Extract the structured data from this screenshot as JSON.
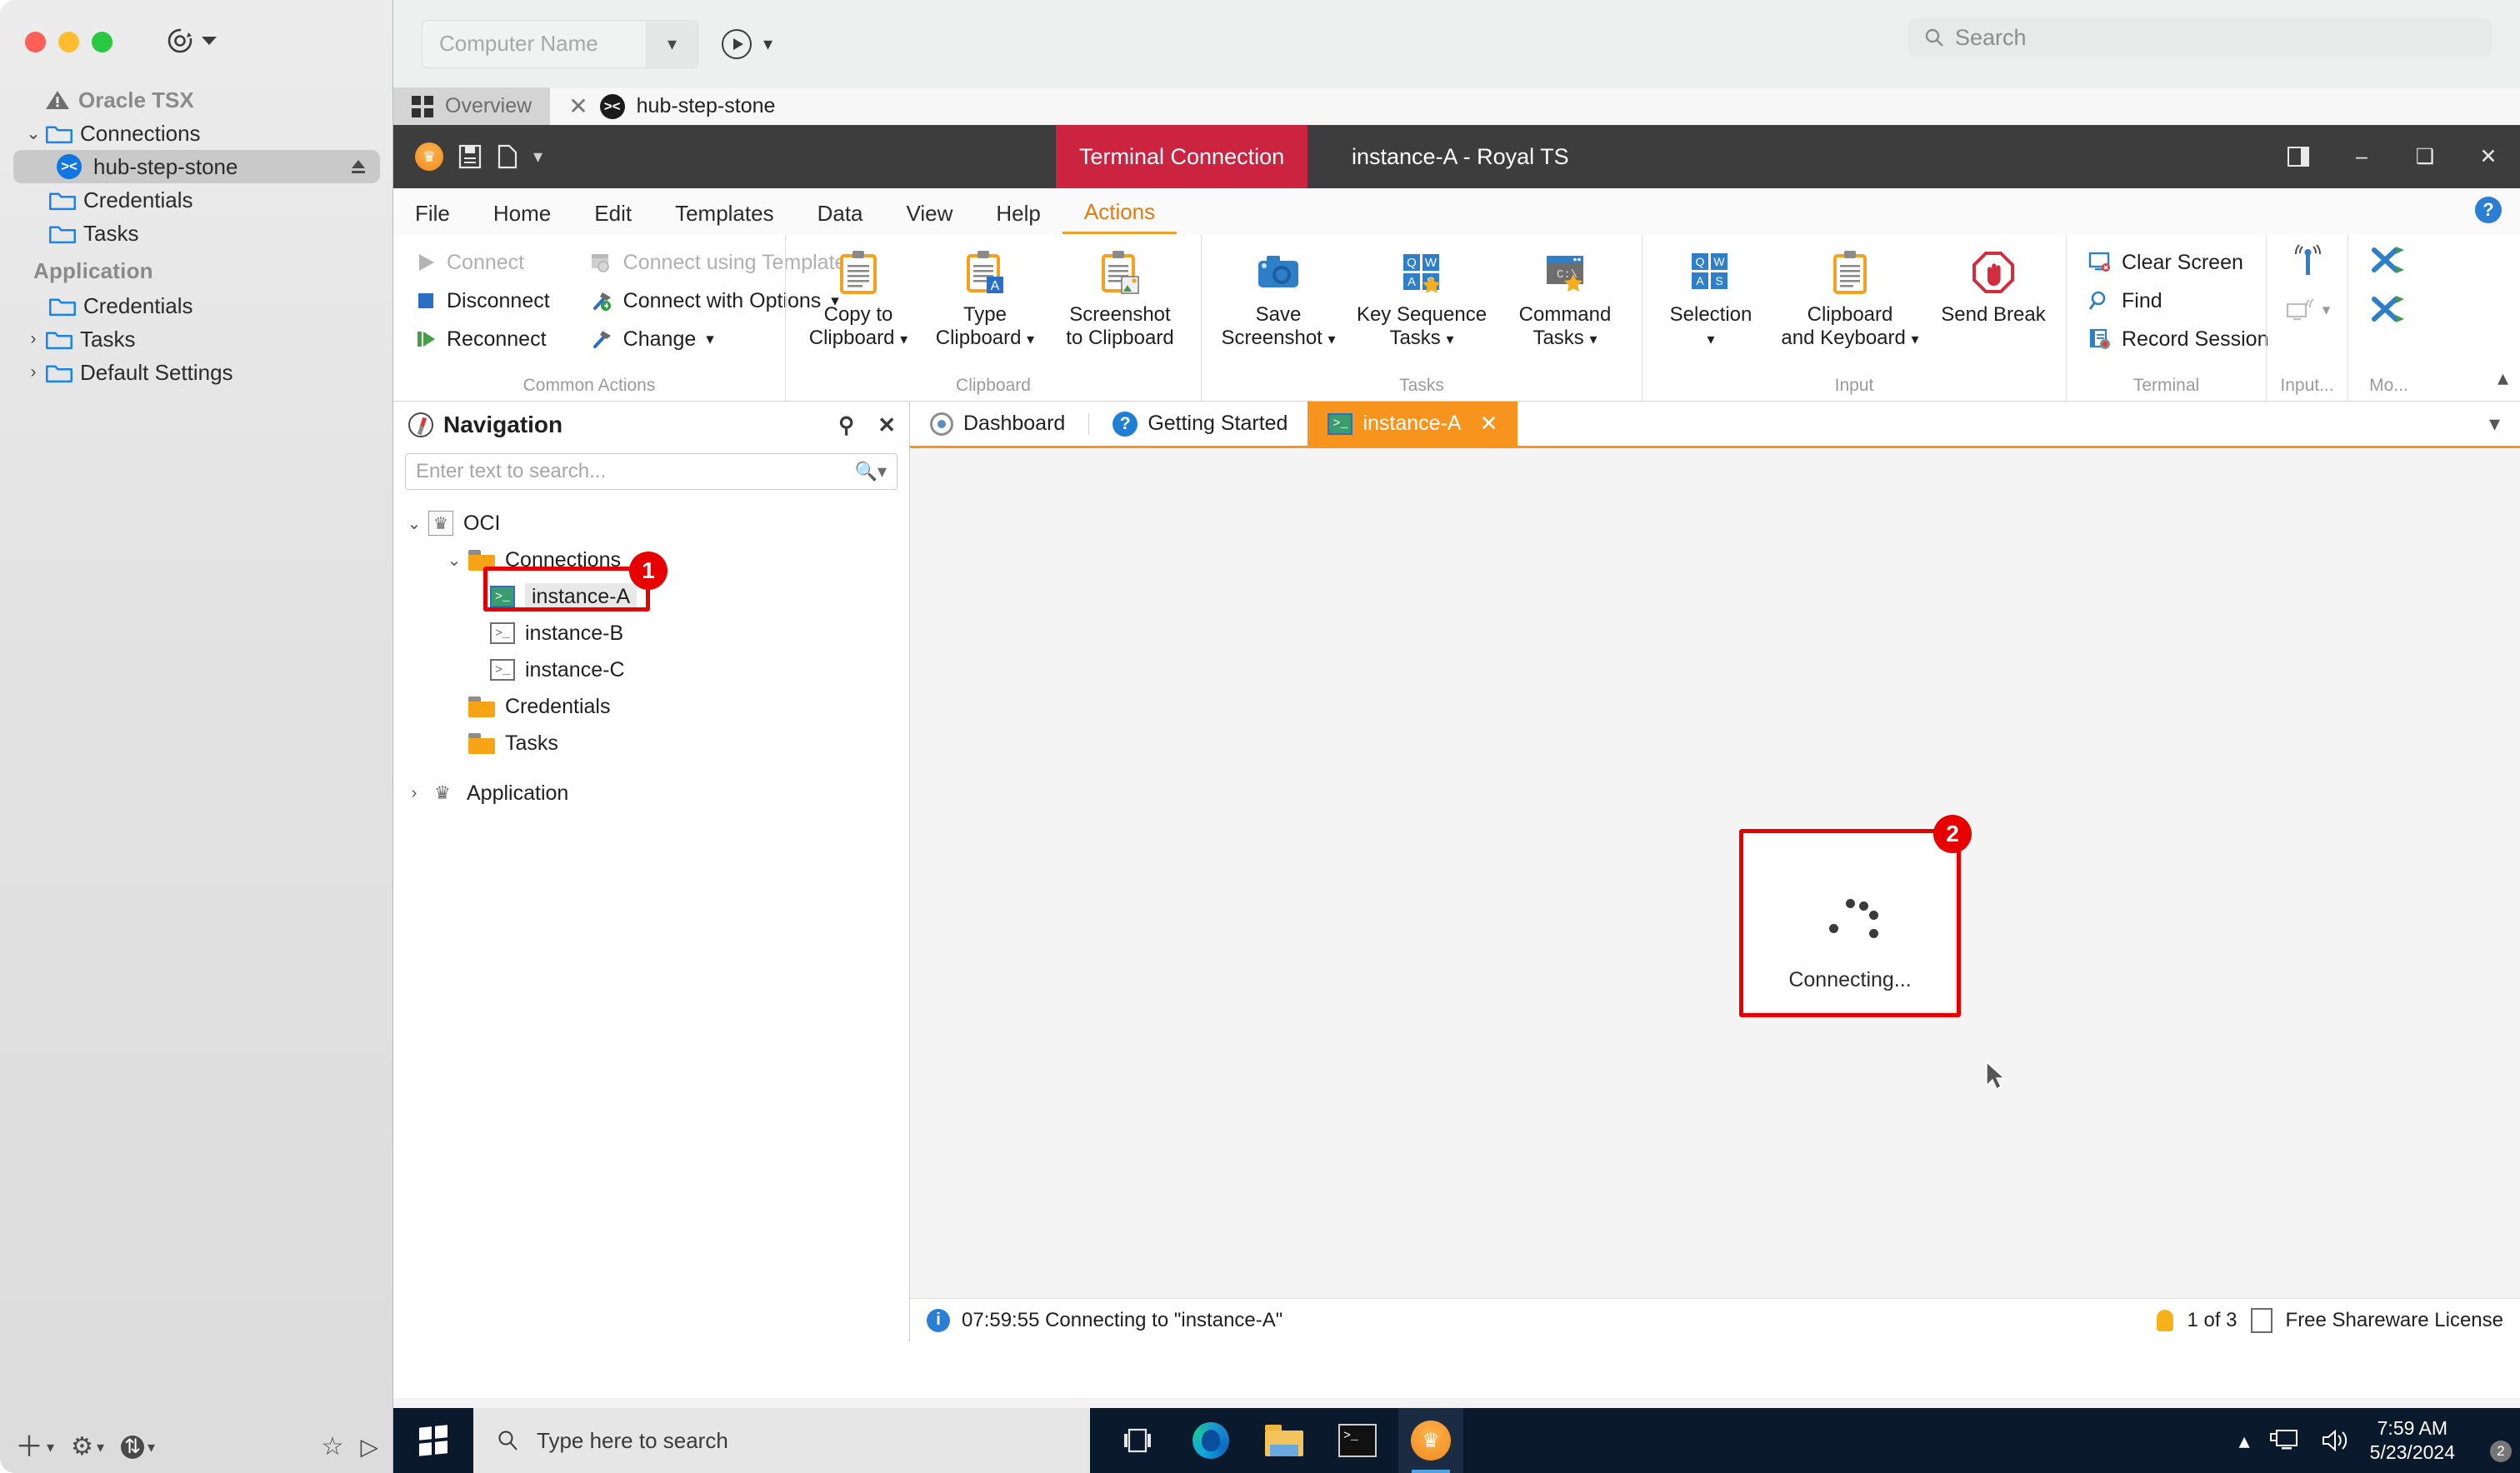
{
  "mac": {
    "toolbar": {
      "record_icon": "record-target-icon",
      "chevron": "chevron-down-icon"
    },
    "sidebar": {
      "group_1": {
        "title": "Oracle TSX",
        "icon": "warning-triangle-icon"
      },
      "items_1": [
        {
          "label": "Connections",
          "icon": "folder-icon",
          "twisty": "⌄",
          "selected": false,
          "kind": "folder"
        },
        {
          "label": "hub-step-stone",
          "icon": "xshell-icon",
          "twisty": "",
          "selected": true,
          "kind": "connection"
        },
        {
          "label": "Credentials",
          "icon": "folder-icon",
          "twisty": "",
          "selected": false,
          "kind": "folder"
        },
        {
          "label": "Tasks",
          "icon": "folder-icon",
          "twisty": "",
          "selected": false,
          "kind": "folder"
        }
      ],
      "group_2": {
        "title": "Application"
      },
      "items_2": [
        {
          "label": "Credentials",
          "icon": "folder-icon",
          "twisty": "",
          "selected": false,
          "kind": "folder"
        },
        {
          "label": "Tasks",
          "icon": "folder-icon",
          "twisty": "›",
          "selected": false,
          "kind": "folder"
        },
        {
          "label": "Default Settings",
          "icon": "folder-icon",
          "twisty": "›",
          "selected": false,
          "kind": "folder"
        }
      ]
    },
    "bottom_bar": [
      {
        "name": "add-button",
        "glyph": "＋"
      },
      {
        "name": "settings-button",
        "glyph": "⚙"
      },
      {
        "name": "transfer-button",
        "glyph": "⇅"
      },
      {
        "name": "favorite-button",
        "glyph": "☆"
      },
      {
        "name": "run-button",
        "glyph": "▷"
      }
    ]
  },
  "vm": {
    "computer_name_placeholder": "Computer Name",
    "search_placeholder": "Search",
    "tabs": [
      {
        "label": "Overview",
        "icon": "grid-icon",
        "active": false,
        "closable": false
      },
      {
        "label": "hub-step-stone",
        "icon": "xshell-icon",
        "active": true,
        "closable": true
      }
    ]
  },
  "royalts": {
    "titlebar": {
      "badge": "Terminal Connection",
      "document_title": "instance-A - Royal TS",
      "quick_access": [
        "royal-logo-icon",
        "save-icon",
        "new-document-icon",
        "customize-qat-icon"
      ],
      "window_buttons": [
        "dock-panel-icon",
        "minimize-icon",
        "restore-icon",
        "close-icon"
      ]
    },
    "menu": {
      "items": [
        "File",
        "Home",
        "Edit",
        "Templates",
        "Data",
        "View",
        "Help",
        "Actions"
      ],
      "active": "Actions",
      "help_icon": "?"
    },
    "ribbon": {
      "groups": [
        {
          "label": "Common Actions",
          "kind": "split",
          "left": [
            {
              "label": "Connect",
              "icon": "play-grey-icon",
              "disabled": true
            },
            {
              "label": "Disconnect",
              "icon": "stop-blue-icon",
              "disabled": false
            },
            {
              "label": "Reconnect",
              "icon": "play-green-icon",
              "disabled": false
            }
          ],
          "right": [
            {
              "label": "Connect using Template",
              "icon": "template-icon",
              "disabled": true,
              "dropdown": true
            },
            {
              "label": "Connect with Options",
              "icon": "hammer-green-icon",
              "disabled": false,
              "dropdown": true
            },
            {
              "label": "Change",
              "icon": "hammer-icon",
              "disabled": false,
              "dropdown": true
            }
          ]
        },
        {
          "label": "Clipboard",
          "kind": "big",
          "buttons": [
            {
              "line1": "Copy to",
              "line2": "Clipboard",
              "icon": "clipboard-icon",
              "dropdown": true
            },
            {
              "line1": "Type",
              "line2": "Clipboard",
              "icon": "clipboard-type-icon",
              "dropdown": true
            },
            {
              "line1": "Screenshot",
              "line2": "to Clipboard",
              "icon": "clipboard-image-icon",
              "dropdown": false
            }
          ]
        },
        {
          "label": "Tasks",
          "kind": "big",
          "buttons": [
            {
              "line1": "Save",
              "line2": "Screenshot",
              "icon": "camera-icon",
              "dropdown": true
            },
            {
              "line1": "Key Sequence",
              "line2": "Tasks",
              "icon": "key-sequence-icon",
              "dropdown": true
            },
            {
              "line1": "Command",
              "line2": "Tasks",
              "icon": "command-task-icon",
              "dropdown": true
            }
          ]
        },
        {
          "label": "Input",
          "kind": "big",
          "buttons": [
            {
              "line1": "Selection",
              "line2": "",
              "icon": "keys-icon",
              "dropdown": true
            },
            {
              "line1": "Clipboard",
              "line2": "and Keyboard",
              "icon": "clipboard-plain-icon",
              "dropdown": true
            },
            {
              "line1": "Send Break",
              "line2": "",
              "icon": "stop-hand-icon",
              "dropdown": false
            }
          ]
        },
        {
          "label": "Terminal",
          "kind": "small",
          "buttons": [
            {
              "label": "Clear Screen",
              "icon": "clear-screen-icon"
            },
            {
              "label": "Find",
              "icon": "magnifier-icon"
            },
            {
              "label": "Record Session",
              "icon": "record-session-icon"
            }
          ]
        },
        {
          "label": "Input...",
          "kind": "iconcol",
          "buttons": [
            {
              "icon": "broadcast-icon",
              "dropdown": false
            },
            {
              "icon": "broadcast-off-icon",
              "dropdown": true
            }
          ]
        },
        {
          "label": "Mo...",
          "kind": "iconcol",
          "buttons": [
            {
              "icon": "shuffle-icon",
              "dropdown": false
            },
            {
              "icon": "shuffle-icon",
              "dropdown": false
            }
          ]
        }
      ],
      "collapse_icon": "chevron-up-icon"
    },
    "navigation": {
      "title": "Navigation",
      "icon": "compass-icon",
      "actions": [
        "auto-hide-pin-icon",
        "close-panel-icon"
      ],
      "search_placeholder": "Enter text to search...",
      "tree": [
        {
          "label": "OCI",
          "depth": 0,
          "twisty": "⌄",
          "icon": "document-crown-icon"
        },
        {
          "label": "Connections",
          "depth": 1,
          "twisty": "⌄",
          "icon": "folder-icon"
        },
        {
          "label": "instance-A",
          "depth": 2,
          "twisty": "",
          "icon": "terminal-icon-active",
          "selected": true
        },
        {
          "label": "instance-B",
          "depth": 2,
          "twisty": "",
          "icon": "terminal-icon"
        },
        {
          "label": "instance-C",
          "depth": 2,
          "twisty": "",
          "icon": "terminal-icon"
        },
        {
          "label": "Credentials",
          "depth": 1,
          "twisty": "",
          "icon": "folder-icon"
        },
        {
          "label": "Tasks",
          "depth": 1,
          "twisty": "",
          "icon": "folder-icon"
        },
        {
          "label": "Application",
          "depth": 0,
          "twisty": "›",
          "icon": "crown-icon"
        }
      ]
    },
    "document_tabs": [
      {
        "label": "Dashboard",
        "icon": "dashboard-icon",
        "active": false,
        "closable": false
      },
      {
        "label": "Getting Started",
        "icon": "question-icon",
        "active": false,
        "closable": false
      },
      {
        "label": "instance-A",
        "icon": "terminal-icon",
        "active": true,
        "closable": true
      }
    ],
    "document_tabs_overflow_icon": "chevron-down-icon",
    "canvas": {
      "connecting_label": "Connecting...",
      "spinner_icon": "spinner-dots-icon",
      "cursor_icon": "mouse-pointer-icon"
    },
    "status_bar": {
      "message": "07:59:55 Connecting to \"instance-A\"",
      "info_icon": "info-icon",
      "tip_counter": "1 of 3",
      "tip_icon": "lightbulb-icon",
      "license": "Free Shareware License",
      "license_icon": "certificate-icon"
    }
  },
  "annotations": [
    {
      "number": "1",
      "target": "instance-A tree node"
    },
    {
      "number": "2",
      "target": "Connecting dialog"
    }
  ],
  "taskbar": {
    "start_icon": "windows-logo-icon",
    "search_placeholder": "Type here to search",
    "search_icon": "magnifier-icon",
    "items": [
      {
        "name": "task-view-icon"
      },
      {
        "name": "edge-icon"
      },
      {
        "name": "file-explorer-icon"
      },
      {
        "name": "command-prompt-icon"
      },
      {
        "name": "royal-ts-icon",
        "active": true
      }
    ],
    "tray": {
      "overflow_icon": "chevron-up-icon",
      "network_icon": "network-icon",
      "volume_icon": "volume-icon",
      "time": "7:59 AM",
      "date": "5/23/2024",
      "notifications_icon": "notifications-icon",
      "notifications_count": "2"
    }
  },
  "colors": {
    "accent_orange": "#f7941e",
    "badge_red": "#cc2440",
    "highlight_red": "#e60000",
    "titlebar_dark": "#3d3d3d",
    "taskbar_dark": "#0a192b"
  }
}
